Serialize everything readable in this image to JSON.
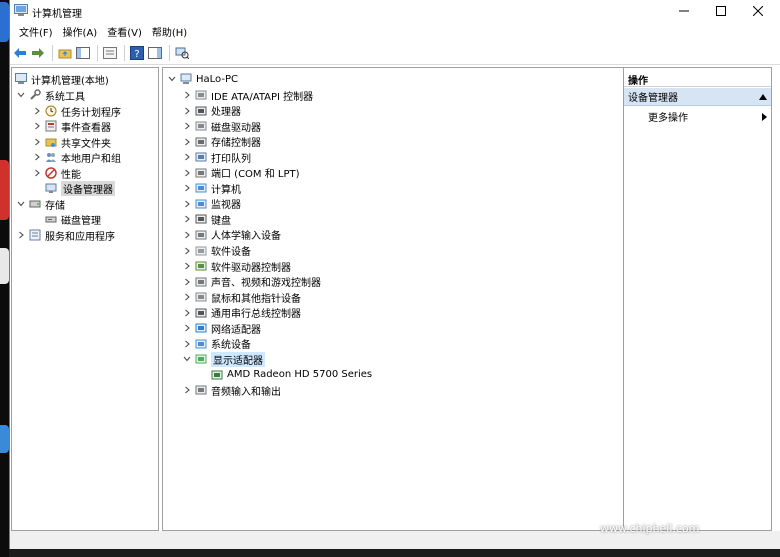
{
  "window": {
    "title": "计算机管理",
    "controls": [
      "minimize-icon",
      "maximize-icon",
      "close-icon"
    ]
  },
  "menu": [
    "文件(F)",
    "操作(A)",
    "查看(V)",
    "帮助(H)"
  ],
  "left_tree": {
    "root": "计算机管理(本地)",
    "system_tools": "系统工具",
    "system_tools_children": [
      "任务计划程序",
      "事件查看器",
      "共享文件夹",
      "本地用户和组",
      "性能",
      "设备管理器"
    ],
    "storage": "存储",
    "storage_children": [
      "磁盘管理"
    ],
    "services": "服务和应用程序"
  },
  "device_tree": {
    "computer": "HaLo-PC",
    "categories": [
      "IDE ATA/ATAPI 控制器",
      "处理器",
      "磁盘驱动器",
      "存储控制器",
      "打印队列",
      "端口 (COM 和 LPT)",
      "计算机",
      "监视器",
      "键盘",
      "人体学输入设备",
      "软件设备",
      "软件驱动器控制器",
      "声音、视频和游戏控制器",
      "鼠标和其他指针设备",
      "通用串行总线控制器",
      "网络适配器",
      "系统设备",
      "显示适配器"
    ],
    "expanded_child": "AMD Radeon HD 5700 Series",
    "last_category": "音频输入和输出"
  },
  "actions": {
    "header": "操作",
    "section": "设备管理器",
    "more": "更多操作"
  },
  "watermark": {
    "logo": "chip hell",
    "url": "www.chiphell.com"
  },
  "colors": {
    "selection": "#d9d9d9",
    "action_section": "#d6e4f3",
    "desktop": "#0c0c0c"
  }
}
